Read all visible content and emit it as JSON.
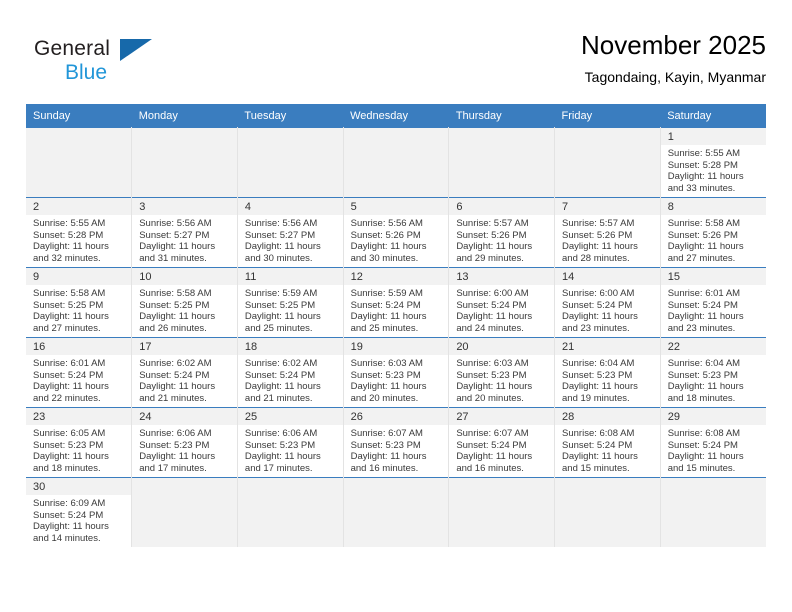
{
  "brand": {
    "name_top": "General",
    "name_bottom": "Blue",
    "triangle_color": "#1769aa",
    "blue_color": "#2196d8"
  },
  "header": {
    "title": "November 2025",
    "subtitle": "Tagondaing, Kayin, Myanmar"
  },
  "theme": {
    "header_bg": "#3a7dbf",
    "header_text": "#ffffff",
    "daynum_bg": "#f2f2f2",
    "cell_text": "#3a3a3a",
    "grid_line": "#3a7dbf"
  },
  "weekdays": [
    "Sunday",
    "Monday",
    "Tuesday",
    "Wednesday",
    "Thursday",
    "Friday",
    "Saturday"
  ],
  "weeks": [
    [
      {
        "day": "",
        "empty": true
      },
      {
        "day": "",
        "empty": true
      },
      {
        "day": "",
        "empty": true
      },
      {
        "day": "",
        "empty": true
      },
      {
        "day": "",
        "empty": true
      },
      {
        "day": "",
        "empty": true
      },
      {
        "day": "1",
        "sunrise": "Sunrise: 5:55 AM",
        "sunset": "Sunset: 5:28 PM",
        "daylight1": "Daylight: 11 hours",
        "daylight2": "and 33 minutes."
      }
    ],
    [
      {
        "day": "2",
        "sunrise": "Sunrise: 5:55 AM",
        "sunset": "Sunset: 5:28 PM",
        "daylight1": "Daylight: 11 hours",
        "daylight2": "and 32 minutes."
      },
      {
        "day": "3",
        "sunrise": "Sunrise: 5:56 AM",
        "sunset": "Sunset: 5:27 PM",
        "daylight1": "Daylight: 11 hours",
        "daylight2": "and 31 minutes."
      },
      {
        "day": "4",
        "sunrise": "Sunrise: 5:56 AM",
        "sunset": "Sunset: 5:27 PM",
        "daylight1": "Daylight: 11 hours",
        "daylight2": "and 30 minutes."
      },
      {
        "day": "5",
        "sunrise": "Sunrise: 5:56 AM",
        "sunset": "Sunset: 5:26 PM",
        "daylight1": "Daylight: 11 hours",
        "daylight2": "and 30 minutes."
      },
      {
        "day": "6",
        "sunrise": "Sunrise: 5:57 AM",
        "sunset": "Sunset: 5:26 PM",
        "daylight1": "Daylight: 11 hours",
        "daylight2": "and 29 minutes."
      },
      {
        "day": "7",
        "sunrise": "Sunrise: 5:57 AM",
        "sunset": "Sunset: 5:26 PM",
        "daylight1": "Daylight: 11 hours",
        "daylight2": "and 28 minutes."
      },
      {
        "day": "8",
        "sunrise": "Sunrise: 5:58 AM",
        "sunset": "Sunset: 5:26 PM",
        "daylight1": "Daylight: 11 hours",
        "daylight2": "and 27 minutes."
      }
    ],
    [
      {
        "day": "9",
        "sunrise": "Sunrise: 5:58 AM",
        "sunset": "Sunset: 5:25 PM",
        "daylight1": "Daylight: 11 hours",
        "daylight2": "and 27 minutes."
      },
      {
        "day": "10",
        "sunrise": "Sunrise: 5:58 AM",
        "sunset": "Sunset: 5:25 PM",
        "daylight1": "Daylight: 11 hours",
        "daylight2": "and 26 minutes."
      },
      {
        "day": "11",
        "sunrise": "Sunrise: 5:59 AM",
        "sunset": "Sunset: 5:25 PM",
        "daylight1": "Daylight: 11 hours",
        "daylight2": "and 25 minutes."
      },
      {
        "day": "12",
        "sunrise": "Sunrise: 5:59 AM",
        "sunset": "Sunset: 5:24 PM",
        "daylight1": "Daylight: 11 hours",
        "daylight2": "and 25 minutes."
      },
      {
        "day": "13",
        "sunrise": "Sunrise: 6:00 AM",
        "sunset": "Sunset: 5:24 PM",
        "daylight1": "Daylight: 11 hours",
        "daylight2": "and 24 minutes."
      },
      {
        "day": "14",
        "sunrise": "Sunrise: 6:00 AM",
        "sunset": "Sunset: 5:24 PM",
        "daylight1": "Daylight: 11 hours",
        "daylight2": "and 23 minutes."
      },
      {
        "day": "15",
        "sunrise": "Sunrise: 6:01 AM",
        "sunset": "Sunset: 5:24 PM",
        "daylight1": "Daylight: 11 hours",
        "daylight2": "and 23 minutes."
      }
    ],
    [
      {
        "day": "16",
        "sunrise": "Sunrise: 6:01 AM",
        "sunset": "Sunset: 5:24 PM",
        "daylight1": "Daylight: 11 hours",
        "daylight2": "and 22 minutes."
      },
      {
        "day": "17",
        "sunrise": "Sunrise: 6:02 AM",
        "sunset": "Sunset: 5:24 PM",
        "daylight1": "Daylight: 11 hours",
        "daylight2": "and 21 minutes."
      },
      {
        "day": "18",
        "sunrise": "Sunrise: 6:02 AM",
        "sunset": "Sunset: 5:24 PM",
        "daylight1": "Daylight: 11 hours",
        "daylight2": "and 21 minutes."
      },
      {
        "day": "19",
        "sunrise": "Sunrise: 6:03 AM",
        "sunset": "Sunset: 5:23 PM",
        "daylight1": "Daylight: 11 hours",
        "daylight2": "and 20 minutes."
      },
      {
        "day": "20",
        "sunrise": "Sunrise: 6:03 AM",
        "sunset": "Sunset: 5:23 PM",
        "daylight1": "Daylight: 11 hours",
        "daylight2": "and 20 minutes."
      },
      {
        "day": "21",
        "sunrise": "Sunrise: 6:04 AM",
        "sunset": "Sunset: 5:23 PM",
        "daylight1": "Daylight: 11 hours",
        "daylight2": "and 19 minutes."
      },
      {
        "day": "22",
        "sunrise": "Sunrise: 6:04 AM",
        "sunset": "Sunset: 5:23 PM",
        "daylight1": "Daylight: 11 hours",
        "daylight2": "and 18 minutes."
      }
    ],
    [
      {
        "day": "23",
        "sunrise": "Sunrise: 6:05 AM",
        "sunset": "Sunset: 5:23 PM",
        "daylight1": "Daylight: 11 hours",
        "daylight2": "and 18 minutes."
      },
      {
        "day": "24",
        "sunrise": "Sunrise: 6:06 AM",
        "sunset": "Sunset: 5:23 PM",
        "daylight1": "Daylight: 11 hours",
        "daylight2": "and 17 minutes."
      },
      {
        "day": "25",
        "sunrise": "Sunrise: 6:06 AM",
        "sunset": "Sunset: 5:23 PM",
        "daylight1": "Daylight: 11 hours",
        "daylight2": "and 17 minutes."
      },
      {
        "day": "26",
        "sunrise": "Sunrise: 6:07 AM",
        "sunset": "Sunset: 5:23 PM",
        "daylight1": "Daylight: 11 hours",
        "daylight2": "and 16 minutes."
      },
      {
        "day": "27",
        "sunrise": "Sunrise: 6:07 AM",
        "sunset": "Sunset: 5:24 PM",
        "daylight1": "Daylight: 11 hours",
        "daylight2": "and 16 minutes."
      },
      {
        "day": "28",
        "sunrise": "Sunrise: 6:08 AM",
        "sunset": "Sunset: 5:24 PM",
        "daylight1": "Daylight: 11 hours",
        "daylight2": "and 15 minutes."
      },
      {
        "day": "29",
        "sunrise": "Sunrise: 6:08 AM",
        "sunset": "Sunset: 5:24 PM",
        "daylight1": "Daylight: 11 hours",
        "daylight2": "and 15 minutes."
      }
    ],
    [
      {
        "day": "30",
        "sunrise": "Sunrise: 6:09 AM",
        "sunset": "Sunset: 5:24 PM",
        "daylight1": "Daylight: 11 hours",
        "daylight2": "and 14 minutes."
      },
      {
        "day": "",
        "empty": true
      },
      {
        "day": "",
        "empty": true
      },
      {
        "day": "",
        "empty": true
      },
      {
        "day": "",
        "empty": true
      },
      {
        "day": "",
        "empty": true
      },
      {
        "day": "",
        "empty": true
      }
    ]
  ]
}
